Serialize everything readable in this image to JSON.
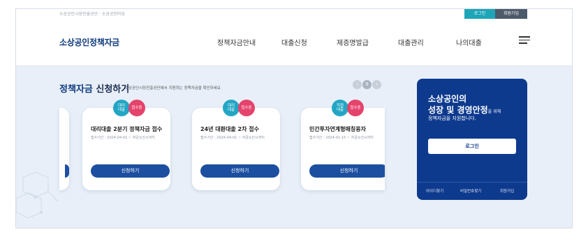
{
  "topbar": {
    "breadcrumb": "소상공인시장진흥공단 · 소상공인마당",
    "login_label": "로그인",
    "join_label": "회원가입"
  },
  "header": {
    "logo": "소상공인정책자금",
    "nav": [
      "정책자금안내",
      "대출신청",
      "제증명발급",
      "대출관리",
      "나의대출"
    ],
    "menu_icon": "hamburger-menu-icon"
  },
  "section": {
    "title_highlight": "정책자금",
    "title_rest": " 신청하기",
    "subtitle": "소상공인시장진흥공단에서 지원하는 정책자금을 확인하세요",
    "pager_prev": "‹",
    "pager_pause": "II",
    "pager_next": "›"
  },
  "cards": [
    {
      "type_badge": "대리\n대출",
      "status_badge": "접수중",
      "title": "대리대출 2분기 정책자금 접수",
      "period": "접수기간 : 2024-04-01 ~ 자금소진시까지",
      "button": "신청하기"
    },
    {
      "type_badge": "대리\n대출",
      "status_badge": "접수중",
      "title": "24년 대환대출 2차 접수",
      "period": "접수기간 : 2024-04-01 ~ 자금소진시까지",
      "button": "신청하기"
    },
    {
      "type_badge": "직접\n대출",
      "status_badge": "접수중",
      "title": "민간투자연계형매칭융자",
      "period": "접수기간 : 2024-01-15 ~ 자금소진시까지",
      "button": "신청하기"
    }
  ],
  "side_panel": {
    "line1": "소상공인의",
    "line2_bold": "성장 및 경영안정",
    "line2_small": "을 위해",
    "line3": "정책자금을 지원합니다.",
    "login_button": "로그인",
    "links": [
      "아이디찾기",
      "비밀번호찾기",
      "회원가입"
    ]
  },
  "colors": {
    "brand_navy": "#0e3a8e",
    "button_blue": "#1c4fa0",
    "badge_teal": "#22a6c4",
    "badge_pink": "#e5436b"
  }
}
